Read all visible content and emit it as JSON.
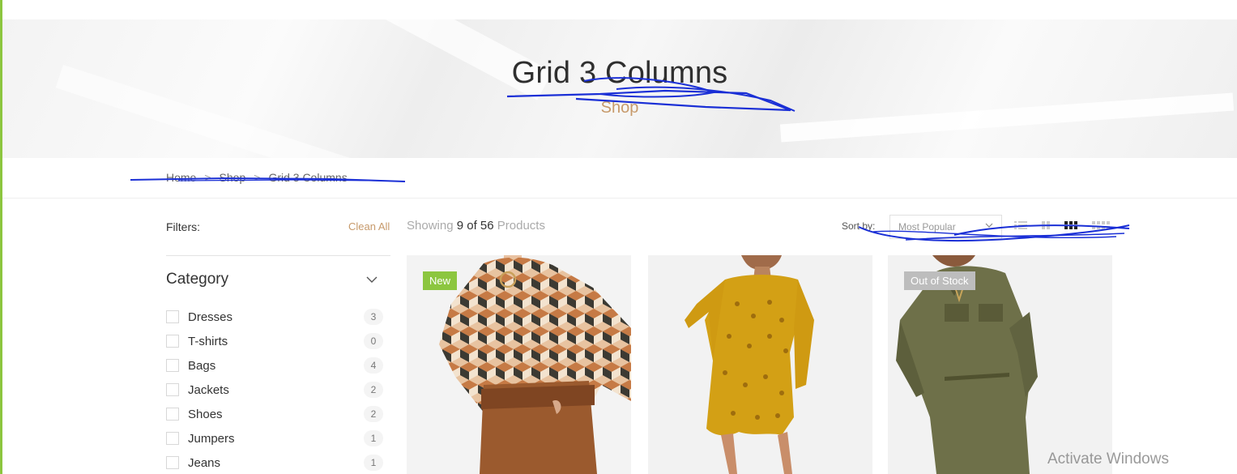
{
  "hero": {
    "title": "Grid 3 Columns",
    "subtitle": "Shop"
  },
  "breadcrumb": [
    {
      "label": "Home"
    },
    {
      "label": "Shop"
    },
    {
      "label": "Grid 3 Columns"
    }
  ],
  "breadcrumb_separator": ">",
  "filters": {
    "label": "Filters:",
    "clean_all": "Clean All",
    "category": {
      "title": "Category",
      "items": [
        {
          "label": "Dresses",
          "count": "3"
        },
        {
          "label": "T-shirts",
          "count": "0"
        },
        {
          "label": "Bags",
          "count": "4"
        },
        {
          "label": "Jackets",
          "count": "2"
        },
        {
          "label": "Shoes",
          "count": "2"
        },
        {
          "label": "Jumpers",
          "count": "1"
        },
        {
          "label": "Jeans",
          "count": "1"
        }
      ]
    }
  },
  "toolbar": {
    "showing_prefix": "Showing",
    "showing_shown": "9",
    "showing_of": "of",
    "showing_total": "56",
    "showing_suffix": "Products",
    "sort_label": "Sort by:",
    "sort_value": "Most Popular",
    "views": [
      "list-view-icon",
      "grid-2-icon",
      "grid-3-icon",
      "grid-4-icon"
    ],
    "active_view": "grid-3-icon"
  },
  "products": [
    {
      "badge": "New",
      "badge_color": "#8cc63f",
      "image": "patterned turtleneck with brown leather paperbag trousers"
    },
    {
      "badge": "",
      "image": "mustard broderie long-sleeve shift dress"
    },
    {
      "badge": "Out of Stock",
      "badge_color": "#bdbdbd",
      "image": "khaki utility boilersuit"
    }
  ],
  "watermark": "Activate Windows",
  "colors": {
    "accent": "#c79a6b",
    "new_badge": "#8cc63f",
    "oos_badge": "#bdbdbd",
    "scribble": "#1a2fd6"
  }
}
